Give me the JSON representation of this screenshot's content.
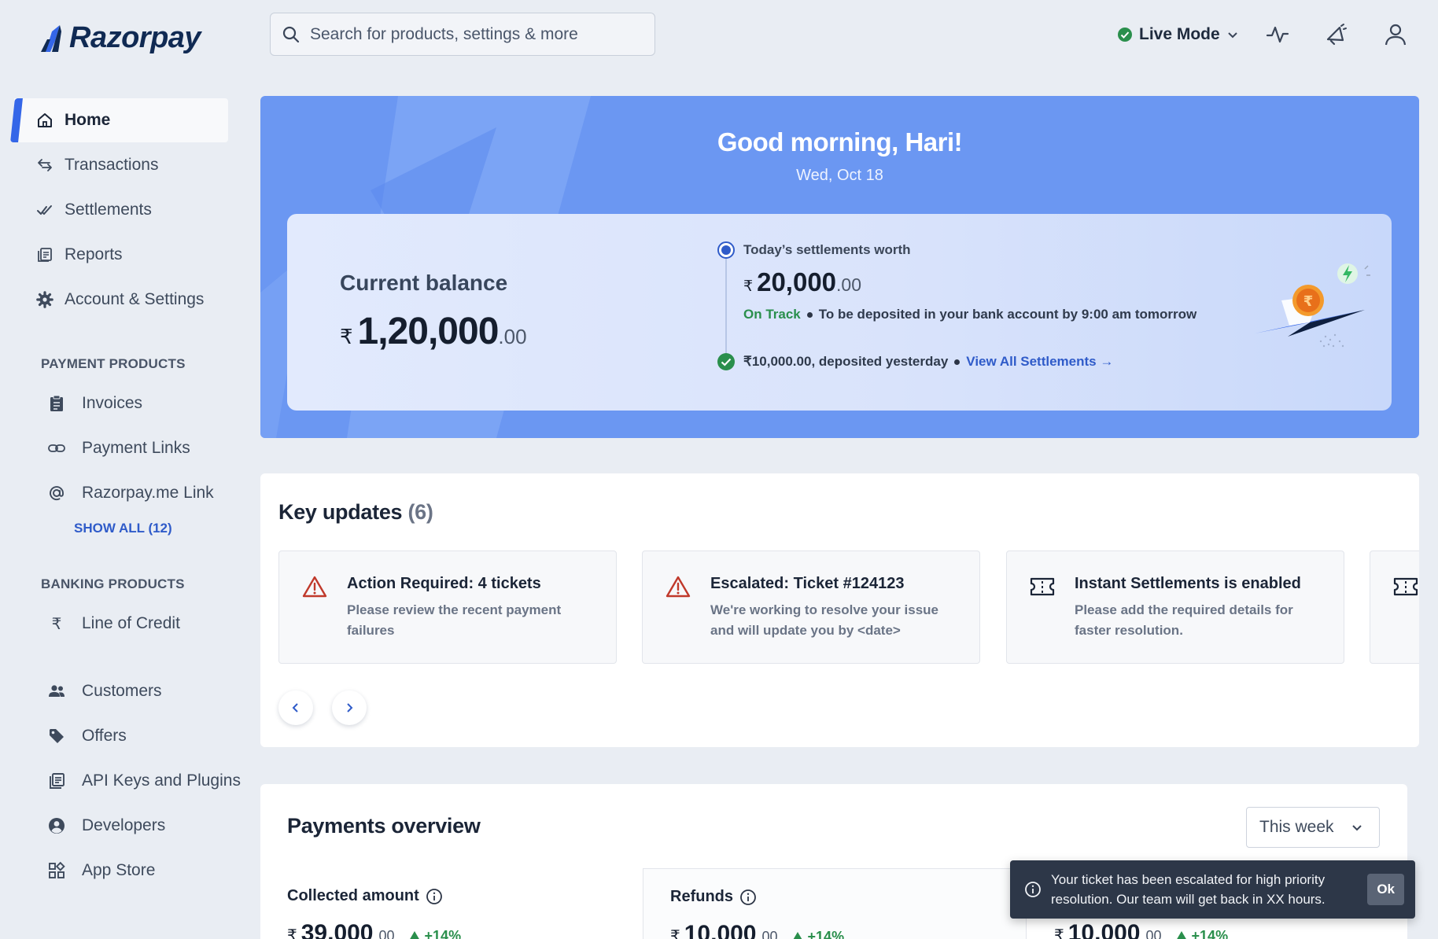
{
  "brand": {
    "name": "Razorpay"
  },
  "search": {
    "placeholder": "Search for products, settings & more"
  },
  "header": {
    "mode_label": "Live Mode",
    "icons": [
      "activity-icon",
      "announcement-icon",
      "user-icon"
    ]
  },
  "sidebar": {
    "main_items": [
      {
        "label": "Home",
        "icon": "home-icon",
        "active": true
      },
      {
        "label": "Transactions",
        "icon": "transactions-icon"
      },
      {
        "label": "Settlements",
        "icon": "settlements-icon"
      },
      {
        "label": "Reports",
        "icon": "reports-icon"
      },
      {
        "label": "Account & Settings",
        "icon": "gear-icon"
      }
    ],
    "payment_products_title": "PAYMENT PRODUCTS",
    "payment_products": [
      {
        "label": "Invoices",
        "icon": "invoice-icon"
      },
      {
        "label": "Payment Links",
        "icon": "link-icon"
      },
      {
        "label": "Razorpay.me Link",
        "icon": "at-icon"
      }
    ],
    "show_all": "SHOW ALL (12)",
    "banking_products_title": "BANKING PRODUCTS",
    "banking_products": [
      {
        "label": "Line of Credit",
        "icon": "rupee-icon"
      }
    ],
    "other_items": [
      {
        "label": "Customers",
        "icon": "customers-icon"
      },
      {
        "label": "Offers",
        "icon": "tag-icon"
      },
      {
        "label": "API Keys and Plugins",
        "icon": "api-icon"
      },
      {
        "label": "Developers",
        "icon": "developer-icon"
      },
      {
        "label": "App Store",
        "icon": "app-store-icon"
      }
    ]
  },
  "hero": {
    "greeting": "Good morning, Hari!",
    "date": "Wed, Oct 18",
    "balance": {
      "label": "Current balance",
      "currency": "₹",
      "amount_main": "1,20,000",
      "amount_decimal": ".00"
    },
    "settlement": {
      "today_label": "Today’s settlements worth",
      "currency": "₹",
      "amount_main": "20,000",
      "amount_decimal": ".00",
      "status": "On Track",
      "status_message": "To be deposited in your bank account by 9:00 am tomorrow",
      "yesterday": "₹10,000.00, deposited yesterday",
      "view_all": "View All Settlements →"
    }
  },
  "key_updates": {
    "title": "Key updates",
    "count": "(6)",
    "cards": [
      {
        "title": "Action Required: 4 tickets",
        "description": "Please review the recent payment failures",
        "icon": "warning-icon"
      },
      {
        "title": "Escalated: Ticket #124123",
        "description": "We're working to resolve your issue and will update you by <date>",
        "icon": "warning-icon"
      },
      {
        "title": "Instant Settlements is enabled",
        "description": "Please add the required details for faster resolution.",
        "icon": "ticket-icon"
      }
    ]
  },
  "payments": {
    "title": "Payments overview",
    "period": "This week",
    "metrics": [
      {
        "label": "Collected amount",
        "currency": "₹",
        "main": "39,000",
        "decimal": ".00",
        "trend": "+14%"
      },
      {
        "label": "Refunds",
        "currency": "₹",
        "main": "10,000",
        "decimal": ".00",
        "trend": "+14%"
      },
      {
        "label": "",
        "currency": "₹",
        "main": "10,000",
        "decimal": ".00",
        "trend": "+14%"
      }
    ]
  },
  "toast": {
    "message": "Your ticket has been escalated for high priority resolution. Our team will get back in XX hours.",
    "action": "Ok"
  },
  "colors": {
    "accent": "#3466e8",
    "hero_bg": "#6b97f2",
    "success": "#2a8f4c",
    "warning": "#c0392b",
    "link": "#2f5bc9"
  }
}
